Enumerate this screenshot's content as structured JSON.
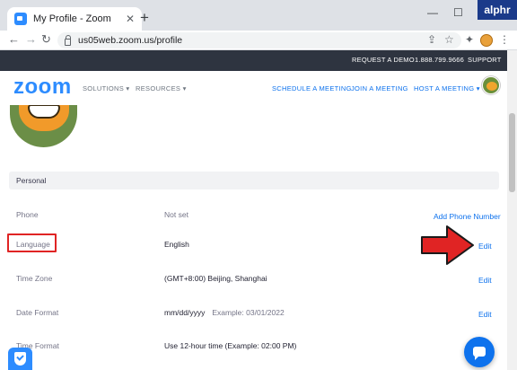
{
  "browser": {
    "tab_title": "My Profile - Zoom",
    "tab_close": "✕",
    "new_tab": "+",
    "url": "us05web.zoom.us/profile",
    "minimize": "—",
    "maximize": "☐",
    "close": "✕",
    "watermark": "alphr"
  },
  "topstrip": {
    "request_demo": "REQUEST A DEMO",
    "phone": "1.888.799.9666",
    "support": "SUPPORT"
  },
  "header": {
    "logo": "zoom",
    "solutions": "SOLUTIONS ▾",
    "resources": "RESOURCES ▾",
    "schedule": "SCHEDULE A MEETING",
    "join": "JOIN A MEETING",
    "host": "HOST A MEETING ▾"
  },
  "section": {
    "title": "Personal"
  },
  "rows": {
    "phone": {
      "label": "Phone",
      "value": "Not set",
      "action": "Add Phone Number"
    },
    "language": {
      "label": "Language",
      "value": "English",
      "action": "Edit"
    },
    "timezone": {
      "label": "Time Zone",
      "value": "(GMT+8:00) Beijing, Shanghai",
      "action": "Edit"
    },
    "dateformat": {
      "label": "Date Format",
      "value": "mm/dd/yyyy",
      "example": "Example: 03/01/2022",
      "action": "Edit"
    },
    "timeformat": {
      "label": "Time Format",
      "value": "Use 12-hour time (Example: 02:00 PM)"
    }
  },
  "colors": {
    "zoom_blue": "#2d8cff",
    "link_blue": "#0e72ed",
    "highlight_red": "#e02424"
  }
}
